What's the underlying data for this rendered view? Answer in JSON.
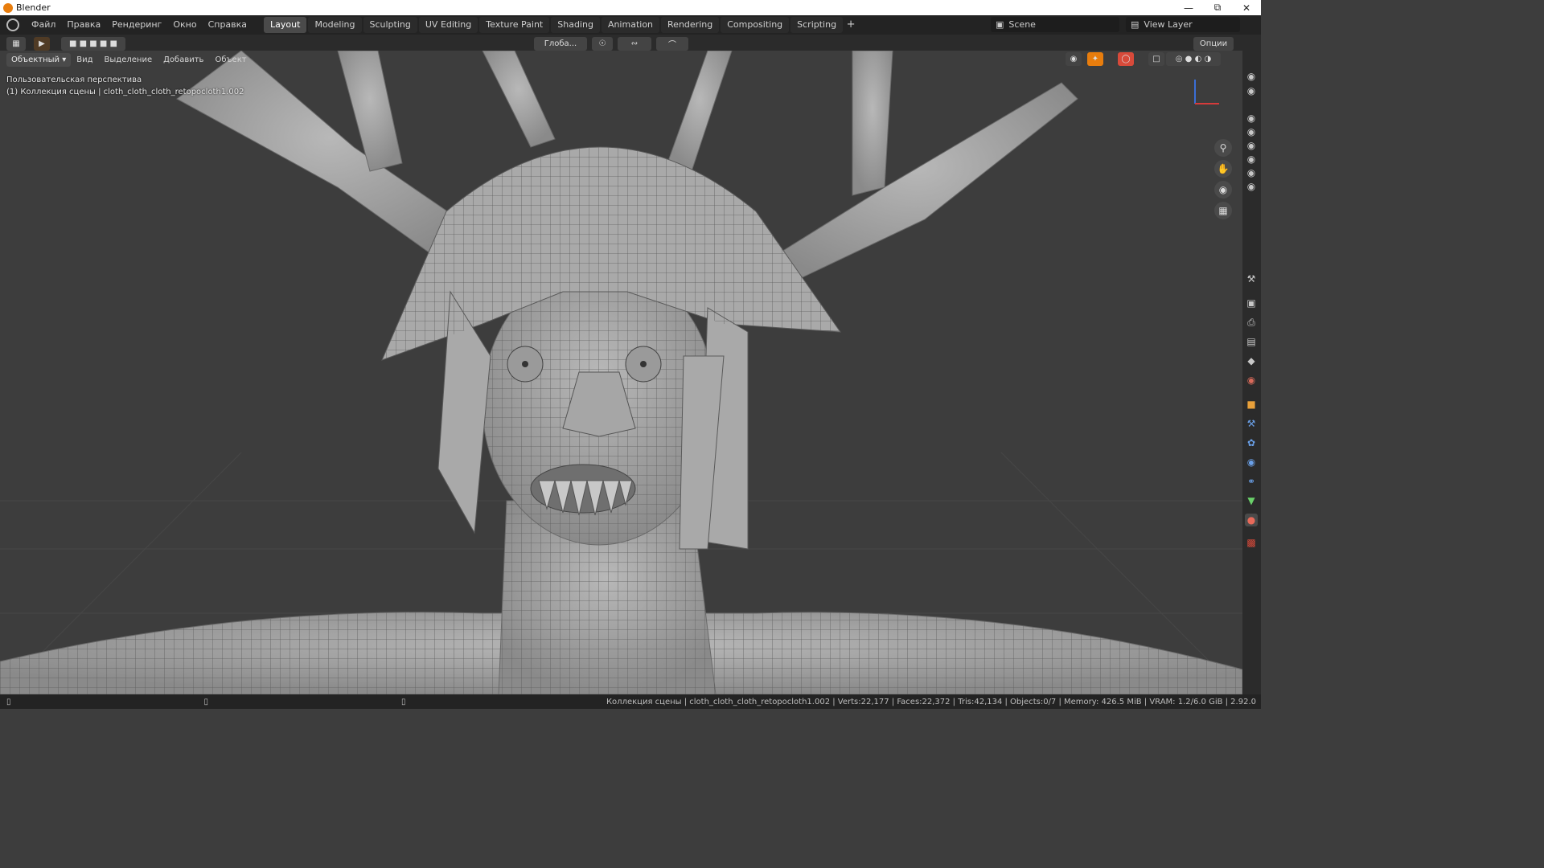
{
  "window": {
    "title": "Blender"
  },
  "menu": {
    "items": [
      "Файл",
      "Правка",
      "Рендеринг",
      "Окно",
      "Справка"
    ]
  },
  "workspaces": {
    "tabs": [
      "Layout",
      "Modeling",
      "Sculpting",
      "UV Editing",
      "Texture Paint",
      "Shading",
      "Animation",
      "Rendering",
      "Compositing",
      "Scripting"
    ],
    "active": "Layout",
    "add_label": "+"
  },
  "scene": {
    "name": "Scene"
  },
  "view_layer": {
    "name": "View Layer"
  },
  "toolbar": {
    "orientation_label": "Глоба...",
    "options_label": "Опции"
  },
  "viewport_header": {
    "mode": "Объектный",
    "menus": [
      "Вид",
      "Выделение",
      "Добавить",
      "Объект"
    ]
  },
  "viewport": {
    "perspective_label": "Пользовательская перспектива",
    "collection_label": "(1) Коллекция сцены | cloth_cloth_cloth_retopocloth1.002"
  },
  "statusbar": {
    "text": "Коллекция сцены | cloth_cloth_cloth_retopocloth1.002 | Verts:22,177 | Faces:22,372 | Tris:42,134 | Objects:0/7 | Memory: 426.5 MiB | VRAM: 1.2/6.0 GiB | 2.92.0"
  },
  "colors": {
    "accent": "#e87d0d",
    "header_bg": "#232323",
    "viewport_bg": "#3d3d3d",
    "active_tab_bg": "#4a4a4a"
  },
  "icons": {
    "titlebar": [
      "blender-logo-icon",
      "minimize-icon",
      "maximize-icon",
      "close-icon"
    ],
    "navigation": [
      "zoom-icon",
      "pan-hand-icon",
      "camera-icon",
      "grid-ortho-icon"
    ],
    "outliner_visibility": "eye-icon",
    "properties": [
      "tool-icon",
      "render-icon",
      "output-icon",
      "view-layer-icon",
      "scene-icon",
      "world-icon",
      "object-icon",
      "modifier-icon",
      "particles-icon",
      "physics-icon",
      "constraints-icon",
      "data-icon",
      "material-icon",
      "texture-icon"
    ]
  }
}
